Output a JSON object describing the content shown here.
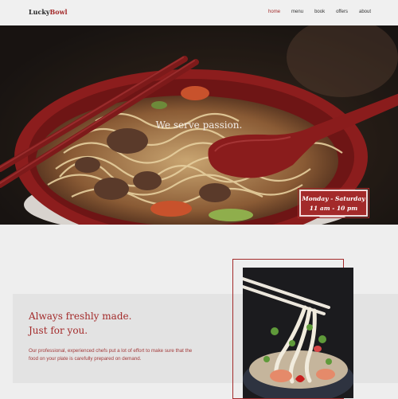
{
  "header": {
    "logo_part1": "Lucky",
    "logo_part2": "Bowl",
    "nav": [
      "home",
      "menu",
      "book",
      "offers",
      "about"
    ],
    "active_nav": "home"
  },
  "hero": {
    "tagline": "We serve passion.",
    "hours_days": "Monday - Saturday",
    "hours_time": "11 am - 10 pm"
  },
  "intro": {
    "headline_line1": "Always freshly made.",
    "headline_line2": "Just for you.",
    "body": "Our professional, experienced chefs put a lot of effort to make sure that the food on your plate is carefully prepared on demand."
  },
  "colors": {
    "accent": "#a32a2a",
    "background": "#eeeeee"
  }
}
